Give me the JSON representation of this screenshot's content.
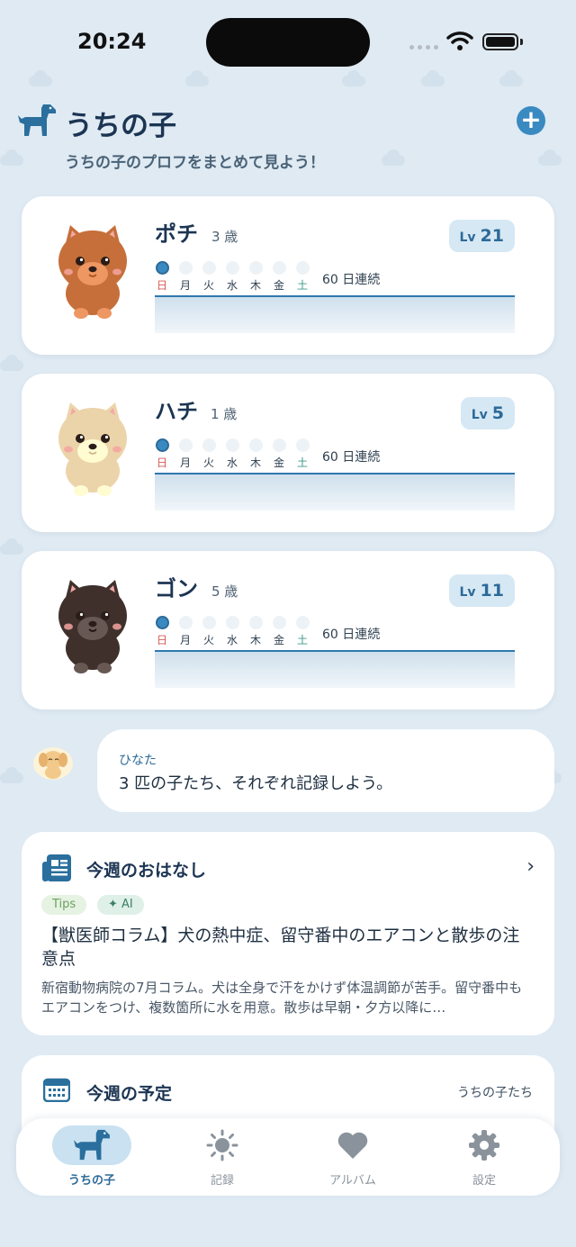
{
  "status_bar": {
    "time": "20:24"
  },
  "header": {
    "title": "うちの子",
    "subtitle": "うちの子のプロフをまとめて見よう！",
    "add_label": "+"
  },
  "weekdays": [
    "日",
    "月",
    "火",
    "水",
    "木",
    "金",
    "土"
  ],
  "pets": [
    {
      "name": "ポチ",
      "age": "3 歳",
      "lv_label": "Lv",
      "lv": "21",
      "streak": "60 日連続",
      "fur_color": "#c66f3a",
      "active_days": [
        0
      ]
    },
    {
      "name": "ハチ",
      "age": "1 歳",
      "lv_label": "Lv",
      "lv": "5",
      "streak": "60 日連続",
      "fur_color": "#ecd4aa",
      "active_days": [
        0
      ]
    },
    {
      "name": "ゴン",
      "age": "5 歳",
      "lv_label": "Lv",
      "lv": "11",
      "streak": "60 日連続",
      "fur_color": "#3f302c",
      "active_days": [
        0
      ]
    }
  ],
  "speech": {
    "speaker": "ひなた",
    "text": "3 匹の子たち、それぞれ記録しよう。"
  },
  "news": {
    "title": "今週のおはなし",
    "tags": [
      "Tips",
      "✦ AI"
    ],
    "headline": "【獣医師コラム】犬の熱中症、留守番中のエアコンと散歩の注意点",
    "body": "新宿動物病院の7月コラム。犬は全身で汗をかけず体温調節が苦手。留守番中もエアコンをつけ、複数箇所に水を用意。散歩は早朝・夕方以降に…"
  },
  "schedule": {
    "title": "今週の予定",
    "filter": "うちの子たち"
  },
  "tabs": [
    {
      "label": "うちの子",
      "icon": "dog-icon",
      "active": true
    },
    {
      "label": "記録",
      "icon": "sun-icon",
      "active": false
    },
    {
      "label": "アルバム",
      "icon": "heart-icon",
      "active": false
    },
    {
      "label": "設定",
      "icon": "gear-icon",
      "active": false
    }
  ],
  "colors": {
    "accent": "#3a8ac2",
    "background": "#dfeaf3"
  }
}
